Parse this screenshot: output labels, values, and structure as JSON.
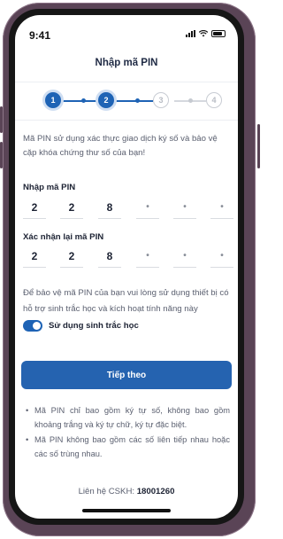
{
  "status_bar": {
    "time": "9:41"
  },
  "header": {
    "title": "Nhập mã PIN"
  },
  "stepper": {
    "steps": [
      {
        "label": "1",
        "state": "active"
      },
      {
        "label": "2",
        "state": "active"
      },
      {
        "label": "3",
        "state": "inactive"
      },
      {
        "label": "4",
        "state": "inactive"
      }
    ]
  },
  "description": "Mã PIN sử dụng xác thực giao dịch ký số và bảo vệ cặp khóa chứng thư số của bạn!",
  "pin_entry": {
    "label": "Nhập mã PIN",
    "digits": [
      "2",
      "2",
      "8",
      "•",
      "•",
      "•"
    ]
  },
  "pin_confirm": {
    "label": "Xác nhận lại mã PIN",
    "digits": [
      "2",
      "2",
      "8",
      "•",
      "•",
      "•"
    ]
  },
  "biometric": {
    "description": "Để bảo vệ mã PIN của bạn vui lòng sử dụng thiết bị có hỗ trợ sinh trắc học và kích hoạt tính năng này",
    "toggle_label": "Sử dụng sinh trắc học",
    "enabled": true
  },
  "continue_button": "Tiếp theo",
  "notes": [
    "Mã PIN chỉ bao gồm ký tự số, không bao gồm khoảng trắng và ký tự chữ, ký tự đặc biệt.",
    "Mã PIN không bao gồm các số liên tiếp nhau hoặc các số trùng nhau."
  ],
  "contact": {
    "label": "Liên hệ CSKH:",
    "phone": "18001260"
  },
  "colors": {
    "primary": "#2563b0",
    "frame": "#5a4456"
  }
}
